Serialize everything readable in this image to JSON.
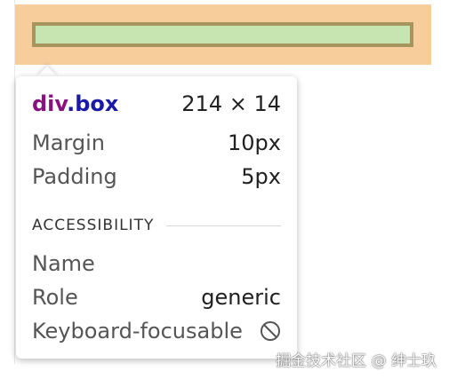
{
  "element": {
    "tag": "div",
    "class_selector": ".box",
    "dimensions": "214 × 14"
  },
  "box_model": {
    "margin_label": "Margin",
    "margin_value": "10px",
    "padding_label": "Padding",
    "padding_value": "5px"
  },
  "accessibility": {
    "section_title": "ACCESSIBILITY",
    "name_label": "Name",
    "name_value": "",
    "role_label": "Role",
    "role_value": "generic",
    "keyboard_label": "Keyboard-focusable",
    "keyboard_icon": "not-allowed-icon"
  },
  "colors": {
    "margin_overlay": "#f7cd9c",
    "border_overlay": "#a7955e",
    "content_overlay": "#c6e5b0",
    "tag_color": "#881280",
    "class_color": "#1a1aa6"
  },
  "watermark": "掘金技术社区 @ 绅士玖"
}
